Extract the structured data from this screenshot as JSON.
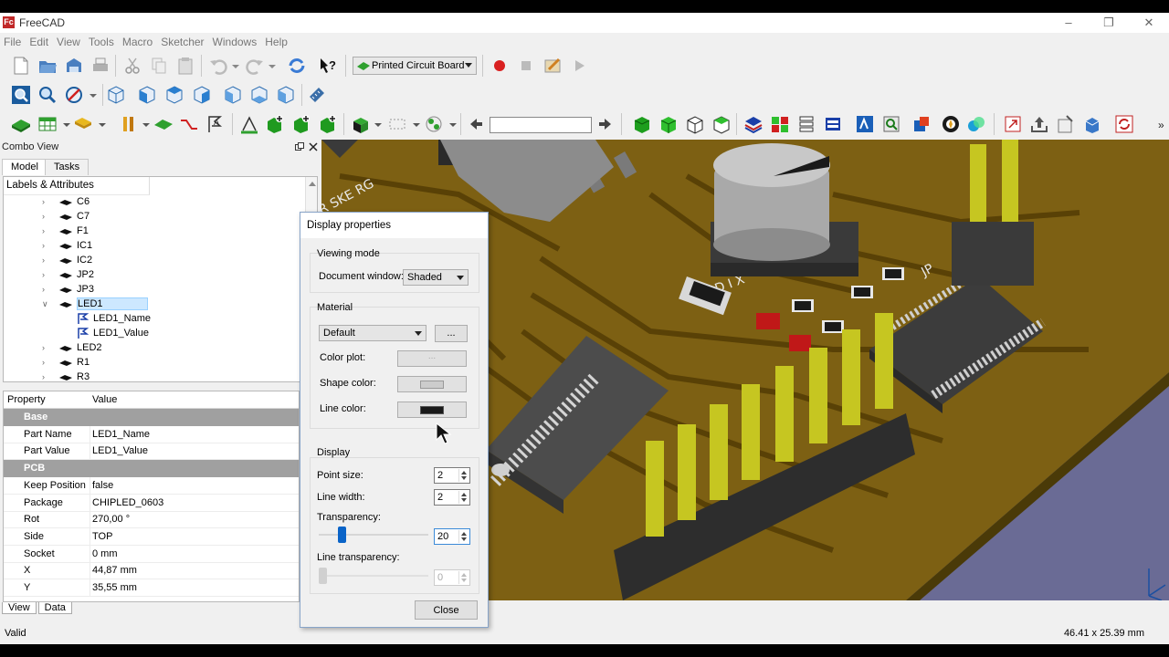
{
  "window": {
    "title": "FreeCAD",
    "logo_text": "Fc"
  },
  "menu": [
    "File",
    "Edit",
    "View",
    "Tools",
    "Macro",
    "Sketcher",
    "Windows",
    "Help"
  ],
  "toolbar": {
    "workbench": "Printed Circuit Board",
    "search_value": ""
  },
  "combo": {
    "title": "Combo View",
    "tabs": [
      "Model",
      "Tasks"
    ],
    "tree_header": "Labels & Attributes",
    "tree": [
      {
        "label": "C6",
        "expanded": false,
        "level": 0
      },
      {
        "label": "C7",
        "expanded": false,
        "level": 0
      },
      {
        "label": "F1",
        "expanded": false,
        "level": 0
      },
      {
        "label": "IC1",
        "expanded": false,
        "level": 0
      },
      {
        "label": "IC2",
        "expanded": false,
        "level": 0
      },
      {
        "label": "JP2",
        "expanded": false,
        "level": 0
      },
      {
        "label": "JP3",
        "expanded": false,
        "level": 0
      },
      {
        "label": "LED1",
        "expanded": true,
        "level": 0,
        "selected": true
      },
      {
        "label": "LED1_Name",
        "level": 1
      },
      {
        "label": "LED1_Value",
        "level": 1
      },
      {
        "label": "LED2",
        "expanded": false,
        "level": 0
      },
      {
        "label": "R1",
        "expanded": false,
        "level": 0
      },
      {
        "label": "R3",
        "expanded": false,
        "level": 0
      }
    ],
    "props_header": {
      "property": "Property",
      "value": "Value"
    },
    "props": [
      {
        "group": "Base"
      },
      {
        "k": "Part Name",
        "v": "LED1_Name"
      },
      {
        "k": "Part Value",
        "v": "LED1_Value"
      },
      {
        "group": "PCB"
      },
      {
        "k": "Keep Position",
        "v": "false"
      },
      {
        "k": "Package",
        "v": "CHIPLED_0603"
      },
      {
        "k": "Rot",
        "v": "270,00 °"
      },
      {
        "k": "Side",
        "v": "TOP"
      },
      {
        "k": "Socket",
        "v": "0 mm"
      },
      {
        "k": "X",
        "v": "44,87 mm"
      },
      {
        "k": "Y",
        "v": "35,55 mm"
      }
    ],
    "bottom_tabs": [
      "View",
      "Data"
    ]
  },
  "dialog": {
    "title": "Display properties",
    "viewing_mode_group": "Viewing mode",
    "document_window_label": "Document window:",
    "document_window_value": "Shaded",
    "material_group": "Material",
    "material_value": "Default",
    "material_more": "...",
    "color_plot_label": "Color plot:",
    "color_plot_value": "...",
    "shape_color_label": "Shape color:",
    "line_color_label": "Line color:",
    "shape_color": "#cccccc",
    "line_color": "#191919",
    "display_group": "Display",
    "point_size_label": "Point size:",
    "point_size": "2",
    "line_width_label": "Line width:",
    "line_width": "2",
    "transparency_label": "Transparency:",
    "transparency": "20",
    "line_transparency_label": "Line transparency:",
    "line_transparency": "0",
    "close": "Close"
  },
  "status": {
    "left": "Valid",
    "right": "46.41 x 25.39 mm"
  }
}
